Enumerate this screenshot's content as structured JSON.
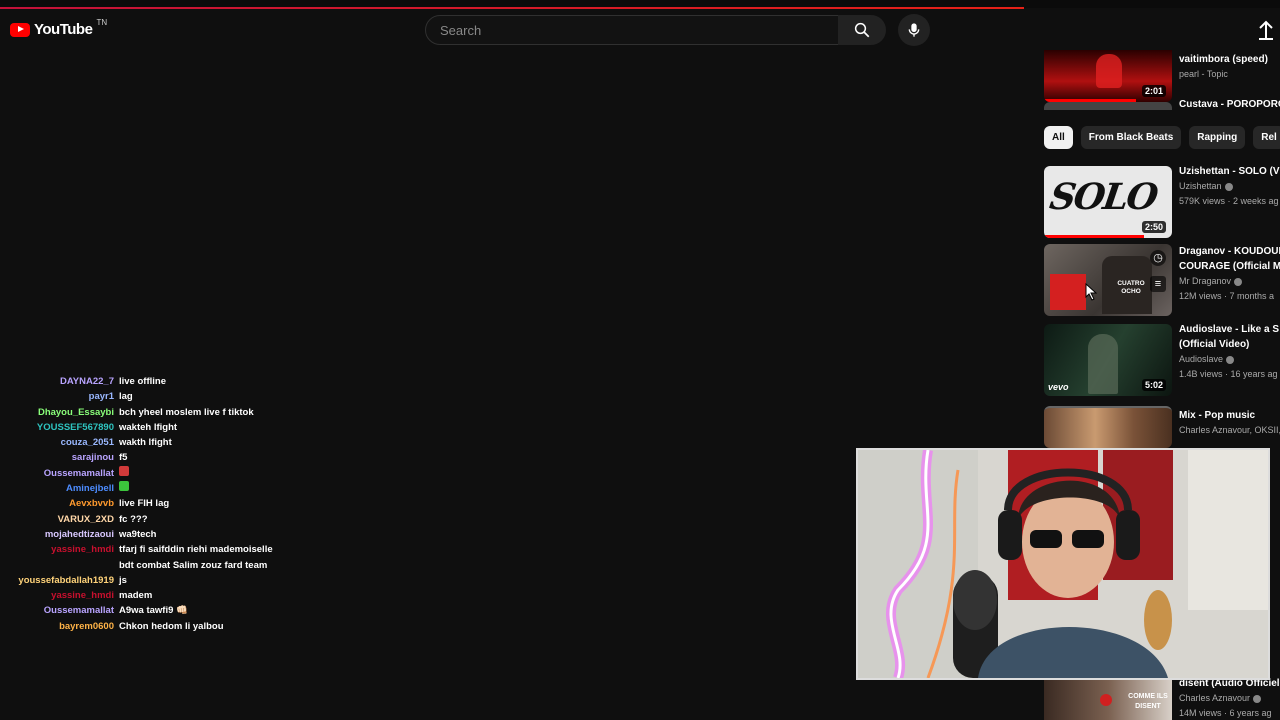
{
  "header": {
    "logo_text": "YouTube",
    "logo_tm": "TN",
    "search_placeholder": "Search",
    "progress_fraction": 0.8
  },
  "chat": [
    {
      "user": "DAYNA22_7",
      "color": "#b9a4ff",
      "msg": "live offline"
    },
    {
      "user": "payr1",
      "color": "#9ab8ff",
      "msg": "lag"
    },
    {
      "user": "Dhayou_Essaybi",
      "color": "#8aff7a",
      "msg": "bch yheel moslem live f tiktok"
    },
    {
      "user": "YOUSSEF567890",
      "color": "#2ec4c0",
      "msg": "wakteh lfight"
    },
    {
      "user": "couza_2051",
      "color": "#9ab8ff",
      "msg": "wakth lfight"
    },
    {
      "user": "sarajinou",
      "color": "#b9a4ff",
      "msg": "f5"
    },
    {
      "user": "Oussemamallat",
      "color": "#b9a4ff",
      "msg": "",
      "emote": "#d13a3a"
    },
    {
      "user": "Aminejbell",
      "color": "#4d8cff",
      "msg": "",
      "emote": "#3cc43c"
    },
    {
      "user": "Aevxbvvb",
      "color": "#ff9a2e",
      "msg": "live FIH lag"
    },
    {
      "user": "VARUX_2XD",
      "color": "#ffd7a8",
      "msg": "fc ???"
    },
    {
      "user": "mojahedtizaoui",
      "color": "#d9c8ff",
      "msg": "wa9tech"
    },
    {
      "user": "yassine_hmdi",
      "color": "#c8102e",
      "msg": "tfarj fi saifddin riehi mademoiselle"
    },
    {
      "user": "",
      "color": "#c8102e",
      "msg": "bdt combat Salim zouz fard team"
    },
    {
      "user": "youssefabdallah1919",
      "color": "#ffd37a",
      "msg": "js"
    },
    {
      "user": "yassine_hmdi",
      "color": "#c8102e",
      "msg": "madem"
    },
    {
      "user": "Oussemamallat",
      "color": "#b9a4ff",
      "msg": "A9wa tawfi9 👊🏻"
    },
    {
      "user": "bayrem0600",
      "color": "#ffb347",
      "msg": "Chkon hedom li yalbou"
    }
  ],
  "sidebar": {
    "top_video": {
      "title": "vaitimbora (speed)",
      "channel": "pearl - Topic",
      "duration": "2:01",
      "progress": 0.72,
      "next_title": "Custava - POROPORO (Off"
    },
    "chips": [
      "All",
      "From Black Beats",
      "Rapping",
      "Rel"
    ],
    "videos": [
      {
        "title": "Uzishettan - SOLO (V",
        "title2": "",
        "channel": "Uzishettan",
        "meta": "579K views · 2 weeks ag",
        "duration": "2:50",
        "progress": 0.78,
        "thumb_text": "SOLO"
      },
      {
        "title": "Draganov - KOUDOUR",
        "title2": "COURAGE (Official M",
        "channel": "Mr Draganov",
        "meta": "12M views · 7 months a",
        "duration": "",
        "progress": 0,
        "thumb_text": "CUATRO OCHO"
      },
      {
        "title": "Audioslave - Like a S",
        "title2": "(Official Video)",
        "channel": "Audioslave",
        "meta": "1.4B views · 16 years ag",
        "duration": "5:02",
        "progress": 0,
        "thumb_text": "vevo"
      },
      {
        "title": "Mix - Pop music",
        "title2": "",
        "channel": "Charles Aznavour, OKSII,",
        "meta": "",
        "duration": "",
        "progress": 0,
        "thumb_text": ""
      }
    ],
    "bottom_video": {
      "title": "disent (Audio Officiel",
      "channel": "Charles Aznavour",
      "meta": "14M views · 6 years ag",
      "thumb_text": "COMME ILS DISENT"
    }
  },
  "colors": {
    "accent": "#ff0000",
    "chip_active": "#f1f1f1",
    "chip": "#272727"
  }
}
